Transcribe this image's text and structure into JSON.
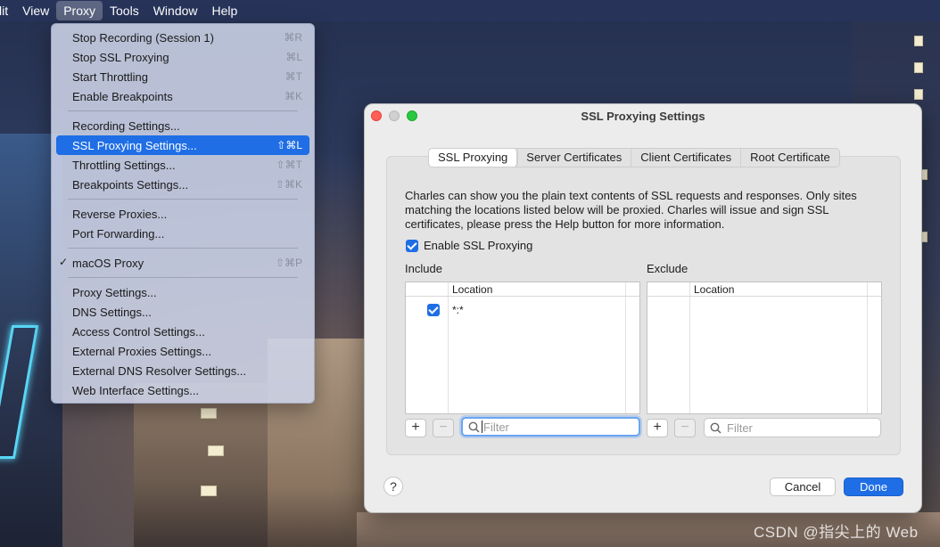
{
  "menubar": {
    "items": [
      "lit",
      "View",
      "Proxy",
      "Tools",
      "Window",
      "Help"
    ],
    "active_index": 2
  },
  "proxy_menu": {
    "groups": [
      [
        {
          "label": "Stop Recording (Session 1)",
          "shortcut": "⌘R"
        },
        {
          "label": "Stop SSL Proxying",
          "shortcut": "⌘L"
        },
        {
          "label": "Start Throttling",
          "shortcut": "⌘T"
        },
        {
          "label": "Enable Breakpoints",
          "shortcut": "⌘K"
        }
      ],
      [
        {
          "label": "Recording Settings...",
          "shortcut": ""
        },
        {
          "label": "SSL Proxying Settings...",
          "shortcut": "⇧⌘L",
          "selected": true
        },
        {
          "label": "Throttling Settings...",
          "shortcut": "⇧⌘T"
        },
        {
          "label": "Breakpoints Settings...",
          "shortcut": "⇧⌘K"
        }
      ],
      [
        {
          "label": "Reverse Proxies...",
          "shortcut": ""
        },
        {
          "label": "Port Forwarding...",
          "shortcut": ""
        }
      ],
      [
        {
          "label": "macOS Proxy",
          "shortcut": "⇧⌘P",
          "checked": true
        }
      ],
      [
        {
          "label": "Proxy Settings...",
          "shortcut": ""
        },
        {
          "label": "DNS Settings...",
          "shortcut": ""
        },
        {
          "label": "Access Control Settings...",
          "shortcut": ""
        },
        {
          "label": "External Proxies Settings...",
          "shortcut": ""
        },
        {
          "label": "External DNS Resolver Settings...",
          "shortcut": ""
        },
        {
          "label": "Web Interface Settings...",
          "shortcut": ""
        }
      ]
    ]
  },
  "dialog": {
    "title": "SSL Proxying Settings",
    "tabs": [
      "SSL Proxying",
      "Server Certificates",
      "Client Certificates",
      "Root Certificate"
    ],
    "active_tab": 0,
    "description": "Charles can show you the plain text contents of SSL requests and responses. Only sites matching the locations listed below will be proxied. Charles will issue and sign SSL certificates, please press the Help button for more information.",
    "enable_label": "Enable SSL Proxying",
    "enable_checked": true,
    "include": {
      "label": "Include",
      "column": "Location",
      "rows": [
        {
          "checked": true,
          "location": "*:*"
        }
      ],
      "filter_placeholder": "Filter"
    },
    "exclude": {
      "label": "Exclude",
      "column": "Location",
      "rows": [],
      "filter_placeholder": "Filter"
    },
    "add_label": "+",
    "remove_label": "−",
    "help_label": "?",
    "cancel_label": "Cancel",
    "done_label": "Done"
  },
  "watermark": "CSDN @指尖上的 Web",
  "colors": {
    "accent": "#1f6ee6",
    "menu_bg": "#cdd4e8"
  }
}
